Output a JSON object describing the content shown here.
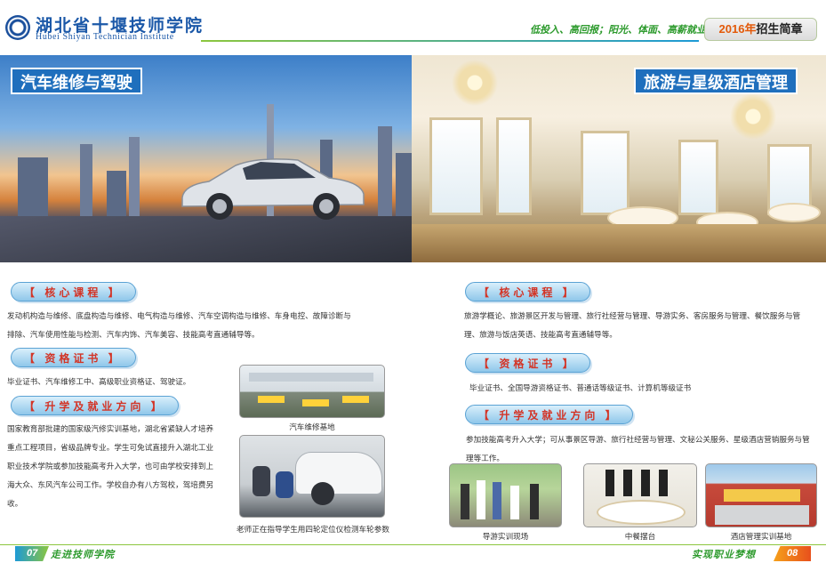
{
  "header": {
    "school_cn": "湖北省十堰技师学院",
    "school_en": "Hubei Shiyan Technician Institute",
    "slogan": "低投入、高回报；阳光、体面、高薪就业",
    "brochure_year": "2016年",
    "brochure_label": "招生简章"
  },
  "left": {
    "hero_title": "汽车维修与驾驶",
    "core_title": "【 核心课程 】",
    "core_text_1": "发动机构造与维修、底盘构造与维修、电气构造与维修、汽车空调构造与维修、车身电控、故障诊断与",
    "core_text_2": "排除、汽车使用性能与检测、汽车内饰、汽车美容、技能高考直通辅导等。",
    "cert_title": "【 资格证书 】",
    "cert_text": "毕业证书、汽车维修工中、高级职业资格证、驾驶证。",
    "career_title": "【 升学及就业方向 】",
    "career_lines": [
      "国家教育部批建的国家级汽修实训基地，湖北省紧缺人才培养",
      "重点工程项目，省级品牌专业。学生可免试直接升入湖北工业",
      "职业技术学院或参加技能高考升入大学，也可由学校安排到上",
      "海大众、东风汽车公司工作。学校自办有八方驾校，驾培费另",
      "收。"
    ],
    "photo1_caption": "汽车维修基地",
    "photo2_caption": "老师正在指导学生用四轮定位仪检测车轮参数"
  },
  "right": {
    "hero_title": "旅游与星级酒店管理",
    "core_title": "【 核心课程 】",
    "core_text_1": "旅游学概论、旅游景区开发与管理、旅行社经营与管理、导游实务、客房服务与管理、餐饮服务与管",
    "core_text_2": "理、旅游与饭店英语、技能高考直通辅导等。",
    "cert_title": "【 资格证书 】",
    "cert_text": "毕业证书、全国导游资格证书、普通话等级证书、计算机等级证书",
    "career_title": "【 升学及就业方向 】",
    "career_text_1": "参加技能高考升入大学；可从事景区导游、旅行社经营与管理、文秘公关服务、星级酒店营销服务与管",
    "career_text_2": "理等工作。",
    "photo1_caption": "导游实训现场",
    "photo2_caption": "中餐摆台",
    "photo3_caption": "酒店管理实训基地"
  },
  "footer": {
    "page_left": "07",
    "text_left": "走进技师学院",
    "text_right": "实现职业梦想",
    "page_right": "08"
  }
}
